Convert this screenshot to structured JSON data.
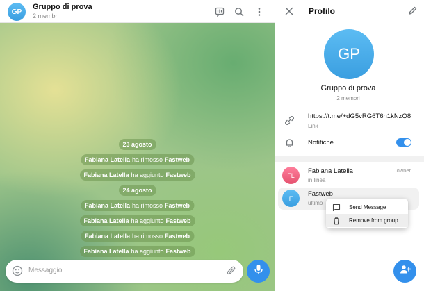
{
  "chat": {
    "avatar_initials": "GP",
    "title": "Gruppo di prova",
    "subtitle": "2 membri",
    "header_icons": [
      "video-chat-icon",
      "search-icon",
      "more-vertical-icon"
    ],
    "service_messages": [
      {
        "type": "date",
        "text": "23 agosto"
      },
      {
        "type": "event",
        "who": "Fabiana Latella",
        "verb": "ha rimosso",
        "what": "Fastweb"
      },
      {
        "type": "event",
        "who": "Fabiana Latella",
        "verb": "ha aggiunto",
        "what": "Fastweb"
      },
      {
        "type": "date",
        "text": "24 agosto"
      },
      {
        "type": "event",
        "who": "Fabiana Latella",
        "verb": "ha rimosso",
        "what": "Fastweb"
      },
      {
        "type": "event",
        "who": "Fabiana Latella",
        "verb": "ha aggiunto",
        "what": "Fastweb"
      },
      {
        "type": "event",
        "who": "Fabiana Latella",
        "verb": "ha rimosso",
        "what": "Fastweb"
      },
      {
        "type": "event",
        "who": "Fabiana Latella",
        "verb": "ha aggiunto",
        "what": "Fastweb"
      }
    ],
    "composer": {
      "placeholder": "Messaggio"
    }
  },
  "profile": {
    "title": "Profilo",
    "avatar_initials": "GP",
    "name": "Gruppo di prova",
    "members_count": "2 membri",
    "link": {
      "value": "https://t.me/+dG5vRG6T6h1kNzQ8",
      "label": "Link"
    },
    "notifications": {
      "label": "Notifiche",
      "enabled": true
    },
    "members": [
      {
        "initials": "FL",
        "name": "Fabiana Latella",
        "status": "in linea",
        "role": "owner",
        "avatar_color": "#ef5a7a"
      },
      {
        "initials": "F",
        "name": "Fastweb",
        "status": "ultimo",
        "role": "",
        "avatar_color": "#3d9be0"
      }
    ],
    "context_menu": [
      {
        "label": "Send Message",
        "icon": "message-icon"
      },
      {
        "label": "Remove from group",
        "icon": "trash-icon"
      }
    ]
  },
  "colors": {
    "accent": "#3390ec",
    "wallpaper_pill": "#6e9650"
  }
}
